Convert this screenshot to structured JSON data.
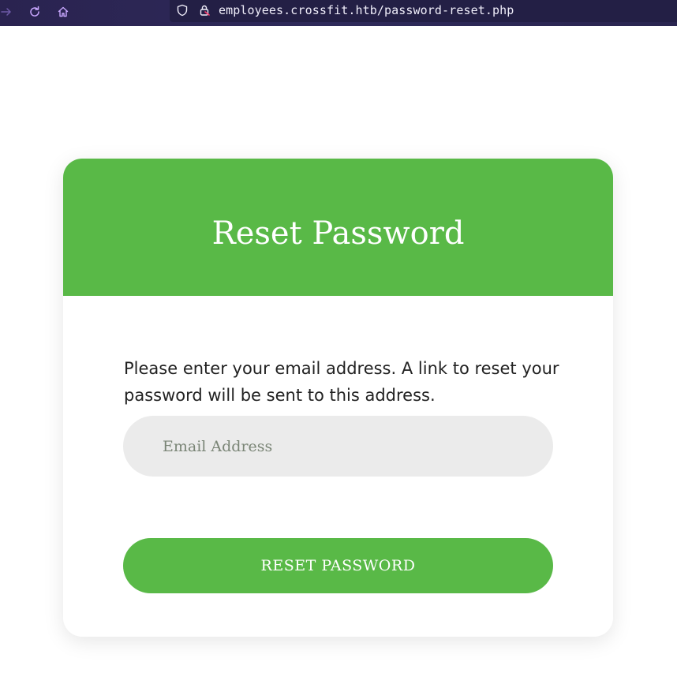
{
  "browser": {
    "url": "employees.crossfit.htb/password-reset.php",
    "icons": {
      "forward": "arrow-right-icon",
      "reload": "reload-icon",
      "home": "home-icon",
      "tracking": "shield-icon",
      "security": "lock-icon"
    },
    "colors": {
      "toolbar": "#2b2a4c",
      "icon": "#c9a7ff"
    }
  },
  "page": {
    "title": "Reset Password",
    "instructions": "Please enter your email address. A link to reset your password will be sent to this address.",
    "email_input": {
      "placeholder": "Email Address",
      "value": ""
    },
    "submit_label": "RESET PASSWORD",
    "colors": {
      "accent": "#59b947",
      "input_bg": "#ebebeb"
    }
  }
}
